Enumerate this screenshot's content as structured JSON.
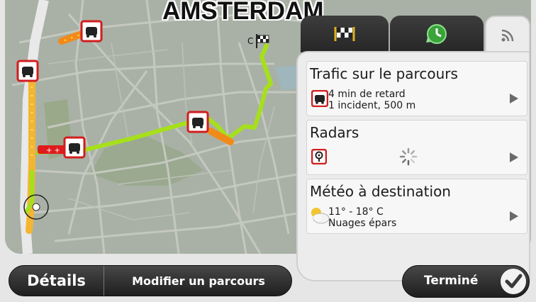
{
  "map": {
    "city_label": "AMSTERDAM"
  },
  "tabs": [
    {
      "name": "destination",
      "icon": "checkered-flag-icon"
    },
    {
      "name": "arrival-time",
      "icon": "clock-arrow-icon"
    },
    {
      "name": "live-services",
      "icon": "signal-icon",
      "active": true
    }
  ],
  "cards": {
    "traffic": {
      "title": "Trafic sur le parcours",
      "line1": "4 min de retard",
      "line2": "1 incident, 500 m",
      "icon": "traffic-jam-icon"
    },
    "radars": {
      "title": "Radars",
      "icon": "speed-camera-icon",
      "status_icon": "loading-spinner-icon"
    },
    "weather": {
      "title": "Météo à destination",
      "line1": "11° - 18° C",
      "line2": "Nuages épars",
      "icon": "partly-cloudy-icon"
    }
  },
  "buttons": {
    "details": "Détails",
    "modify_route": "Modifier un parcours",
    "done": "Terminé"
  },
  "colors": {
    "route": "#a6e01a",
    "traffic": "#f2a12a",
    "incident": "#e01b1b",
    "map_bg": "#a9b1a6"
  }
}
